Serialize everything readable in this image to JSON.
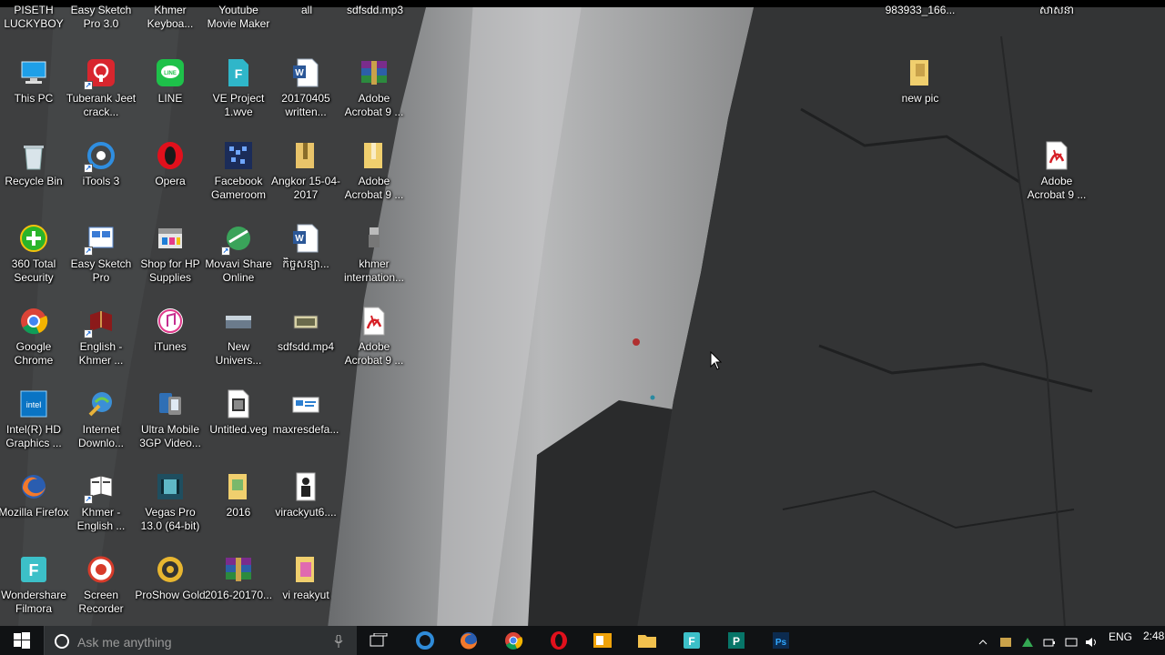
{
  "top_row_partial": [
    {
      "label": "PISETH LUCKYBOY"
    },
    {
      "label": "Easy Sketch Pro 3.0"
    },
    {
      "label": "Khmer Keyboa..."
    },
    {
      "label": "Youtube Movie Maker"
    },
    {
      "label": "all"
    },
    {
      "label": "sdfsdd.mp3"
    },
    {
      "label": "983933_166..."
    },
    {
      "label": "សាសនា"
    }
  ],
  "icons": [
    {
      "label": "This PC",
      "icon": "this-pc-icon"
    },
    {
      "label": "Tuberank Jeet crack...",
      "icon": "tuberank-icon"
    },
    {
      "label": "LINE",
      "icon": "line-app-icon"
    },
    {
      "label": "VE Project 1.wve",
      "icon": "filmora-project-icon"
    },
    {
      "label": "20170405 written...",
      "icon": "word-doc-icon"
    },
    {
      "label": "Adobe Acrobat 9 ...",
      "icon": "winrar-archive-icon"
    },
    {
      "label": "Recycle Bin",
      "icon": "recycle-bin-icon"
    },
    {
      "label": "iTools 3",
      "icon": "itools-icon"
    },
    {
      "label": "Opera",
      "icon": "opera-icon"
    },
    {
      "label": "Facebook Gameroom",
      "icon": "facebook-gameroom-icon"
    },
    {
      "label": "Angkor 15-04-2017",
      "icon": "folder-zip-icon"
    },
    {
      "label": "Adobe Acrobat 9 ...",
      "icon": "folder-icon"
    },
    {
      "label": "360 Total Security",
      "icon": "360-security-icon"
    },
    {
      "label": "Easy Sketch Pro",
      "icon": "easy-sketch-icon"
    },
    {
      "label": "Shop for HP Supplies",
      "icon": "hp-shop-icon"
    },
    {
      "label": "Movavi Share Online",
      "icon": "movavi-icon"
    },
    {
      "label": "កិច្ចសន្យា...",
      "icon": "word-doc-icon"
    },
    {
      "label": "khmer internation...",
      "icon": "usb-drive-icon"
    },
    {
      "label": "Google Chrome",
      "icon": "chrome-icon"
    },
    {
      "label": "English - Khmer ...",
      "icon": "dictionary-icon"
    },
    {
      "label": "iTunes",
      "icon": "itunes-icon"
    },
    {
      "label": "New Univers...",
      "icon": "image-file-icon"
    },
    {
      "label": "sdfsdd.mp4",
      "icon": "video-file-icon"
    },
    {
      "label": "Adobe Acrobat 9 ...",
      "icon": "pdf-icon"
    },
    {
      "label": "Intel(R) HD Graphics ...",
      "icon": "intel-graphics-icon"
    },
    {
      "label": "Internet Downlo...",
      "icon": "idm-icon"
    },
    {
      "label": "Ultra Mobile 3GP Video...",
      "icon": "3gp-converter-icon"
    },
    {
      "label": "Untitled.veg",
      "icon": "vegas-project-icon"
    },
    {
      "label": "maxresdefa...",
      "icon": "image-file-icon"
    },
    {
      "label": "Mozilla Firefox",
      "icon": "firefox-icon"
    },
    {
      "label": "Khmer - English ...",
      "icon": "dictionary-book-icon"
    },
    {
      "label": "Vegas Pro 13.0 (64-bit)",
      "icon": "vegas-pro-icon"
    },
    {
      "label": "2016",
      "icon": "folder-zip-icon"
    },
    {
      "label": "virackyut6....",
      "icon": "portrait-image-icon"
    },
    {
      "label": "Wondershare Filmora",
      "icon": "filmora-icon"
    },
    {
      "label": "Screen Recorder",
      "icon": "screen-recorder-icon"
    },
    {
      "label": "ProShow Gold",
      "icon": "proshow-icon"
    },
    {
      "label": "2016-20170...",
      "icon": "winrar-archive-icon"
    },
    {
      "label": "vi reakyut",
      "icon": "folder-pink-icon"
    },
    {
      "label": "new pic",
      "icon": "folder-icon"
    },
    {
      "label": "Adobe Acrobat 9 ...",
      "icon": "pdf-icon"
    }
  ],
  "taskbar": {
    "search_placeholder": "Ask me anything",
    "language": "ENG",
    "clock": "2:48",
    "pinned": [
      {
        "name": "task-view-icon"
      },
      {
        "name": "edge-icon"
      },
      {
        "name": "firefox-icon"
      },
      {
        "name": "chrome-icon"
      },
      {
        "name": "opera-icon"
      },
      {
        "name": "outlook-icon"
      },
      {
        "name": "file-explorer-icon"
      },
      {
        "name": "filmora-icon"
      },
      {
        "name": "publisher-icon"
      },
      {
        "name": "photoshop-icon"
      }
    ]
  }
}
